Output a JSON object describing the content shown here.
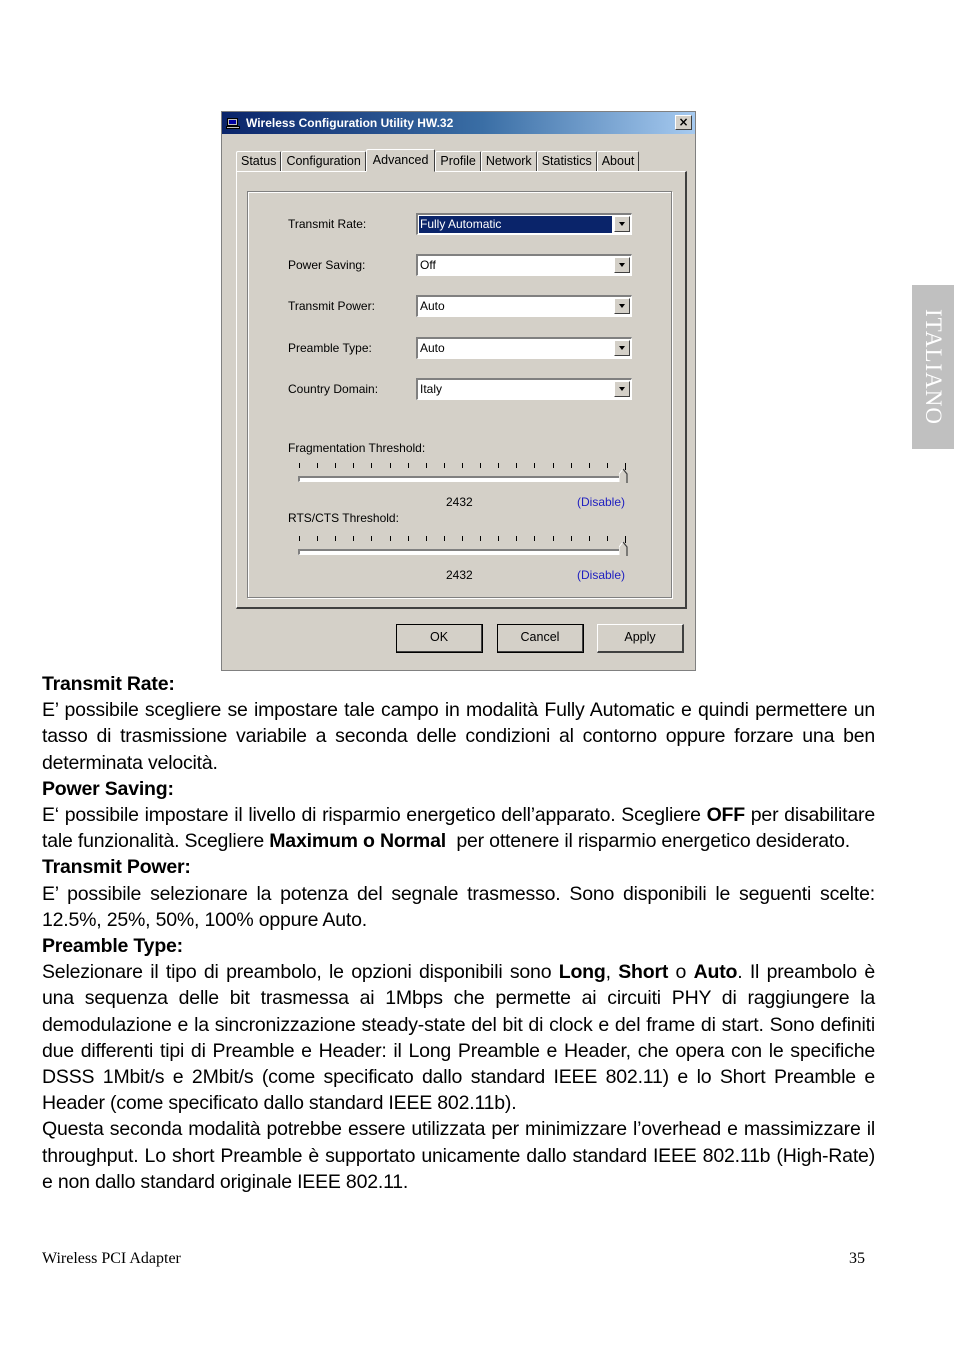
{
  "side_tab": {
    "label": "ITALIANO"
  },
  "dialog": {
    "title": "Wireless Configuration Utility HW.32",
    "close_label": "×",
    "tabs": [
      {
        "label": "Status",
        "active": false
      },
      {
        "label": "Configuration",
        "active": false
      },
      {
        "label": "Advanced",
        "active": true
      },
      {
        "label": "Profile",
        "active": false
      },
      {
        "label": "Network",
        "active": false
      },
      {
        "label": "Statistics",
        "active": false
      },
      {
        "label": "About",
        "active": false
      }
    ],
    "fields": [
      {
        "label": "Transmit Rate:",
        "value": "Fully Automatic",
        "selected": true
      },
      {
        "label": "Power Saving:",
        "value": "Off",
        "selected": false
      },
      {
        "label": "Transmit Power:",
        "value": "Auto",
        "selected": false
      },
      {
        "label": "Preamble Type:",
        "value": "Auto",
        "selected": false
      },
      {
        "label": "Country Domain:",
        "value": "Italy",
        "selected": false
      }
    ],
    "sliders": [
      {
        "label": "Fragmentation Threshold:",
        "value": "2432",
        "state": "(Disable)",
        "position_fraction": 1.0
      },
      {
        "label": "RTS/CTS Threshold:",
        "value": "2432",
        "state": "(Disable)",
        "position_fraction": 1.0
      }
    ],
    "buttons": {
      "ok": "OK",
      "cancel": "Cancel",
      "apply": "Apply"
    }
  },
  "document": {
    "sections": [
      {
        "heading": "Transmit Rate:",
        "body": "E’ possibile scegliere se impostare tale campo in modalità Fully Automatic e quindi permettere un tasso di trasmissione variabile a seconda delle condizioni al contorno oppure forzare una ben determinata velocità."
      },
      {
        "heading": "Power Saving:",
        "body_parts": [
          "E‘ possibile impostare il livello di risparmio energetico dell’apparato. Scegliere ",
          "OFF",
          " per disabilitare tale funzionalità. Scegliere ",
          "Maximum o Normal",
          "  per ottenere il risparmio energetico desiderato."
        ]
      },
      {
        "heading": "Transmit Power:",
        "body": "E’ possibile selezionare la potenza del segnale trasmesso. Sono disponibili le seguenti scelte: 12.5%, 25%, 50%, 100% oppure Auto."
      },
      {
        "heading": "Preamble Type:",
        "body_parts": [
          "Selezionare il tipo di preambolo, le opzioni disponibili sono ",
          "Long",
          ", ",
          "Short",
          " o ",
          "Auto",
          ".  Il preambolo è una sequenza delle bit trasmessa ai 1Mbps che permette ai circuiti PHY di raggiungere la demodulazione e la sincronizzazione steady-state del bit di clock e del frame di start.  Sono definiti due differenti tipi di Preamble e Header:  il Long Preamble e Header, che opera con le specifiche DSSS 1Mbit/s e 2Mbit/s (come specificato dallo standard IEEE 802.11) e lo Short Preamble  e Header (come specificato dallo standard IEEE 802.11b)."
        ],
        "extra": "Questa seconda modalità potrebbe essere utilizzata per minimizzare l’overhead e massimizzare il throughput. Lo short Preamble è supportato unicamente dallo standard IEEE 802.11b (High-Rate) e non dallo standard originale IEEE 802.11."
      }
    ]
  },
  "footer": {
    "left": "Wireless PCI Adapter",
    "page_number": "35"
  }
}
